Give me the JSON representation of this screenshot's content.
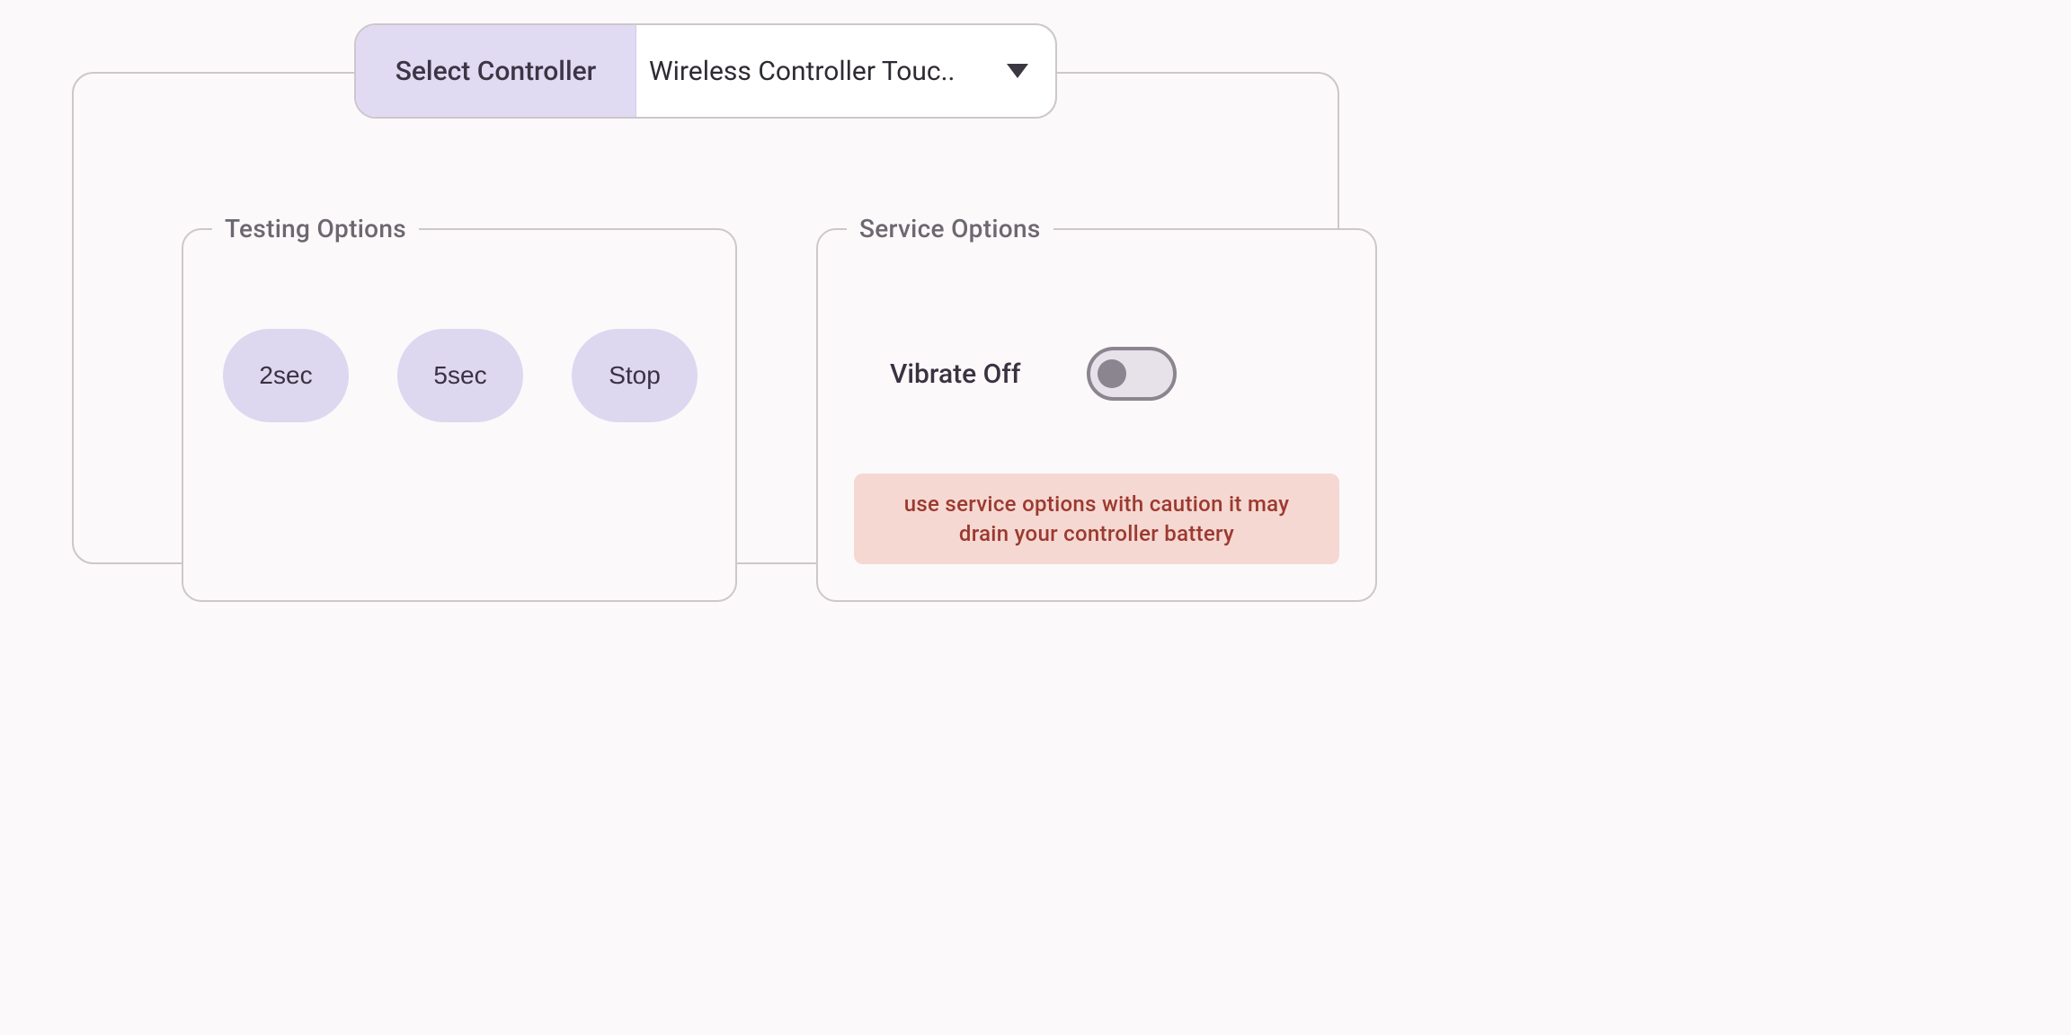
{
  "header": {
    "label": "Select Controller",
    "selected": "Wireless Controller Touc.."
  },
  "testing": {
    "legend": "Testing Options",
    "buttons": {
      "two_sec": "2sec",
      "five_sec": "5sec",
      "stop": "Stop"
    }
  },
  "service": {
    "legend": "Service Options",
    "vibrate_label": "Vibrate Off",
    "vibrate_on": false,
    "warning": "use service options with caution it may drain your controller battery"
  },
  "colors": {
    "accent": "#DED7F0",
    "warn_bg": "#F6D8D2",
    "warn_text": "#9B3A30"
  }
}
